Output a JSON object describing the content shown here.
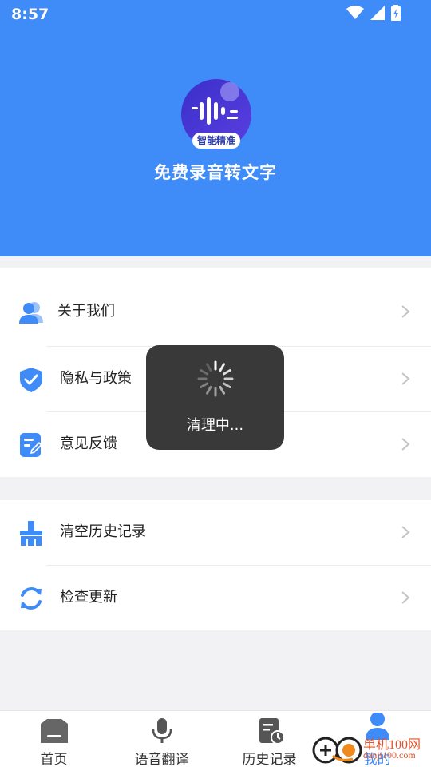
{
  "status_bar": {
    "time": "8:57"
  },
  "header": {
    "app_title": "免费录音转文字",
    "logo_badge": "智能精准"
  },
  "menu_group_1": [
    {
      "label": "关于我们"
    },
    {
      "label": "隐私与政策"
    },
    {
      "label": "意见反馈"
    }
  ],
  "menu_group_2": [
    {
      "label": "清空历史记录"
    },
    {
      "label": "检查更新"
    }
  ],
  "toast": {
    "text": "清理中..."
  },
  "tabbar": {
    "tabs": [
      {
        "label": "首页"
      },
      {
        "label": "语音翻译"
      },
      {
        "label": "历史记录"
      },
      {
        "label": "我的"
      }
    ]
  },
  "watermark": {
    "text": "单机100网",
    "url": "danji100.com"
  },
  "colors": {
    "accent": "#3f8bf7",
    "header_bg": "#3f8bf7",
    "toast_bg": "#282828"
  }
}
